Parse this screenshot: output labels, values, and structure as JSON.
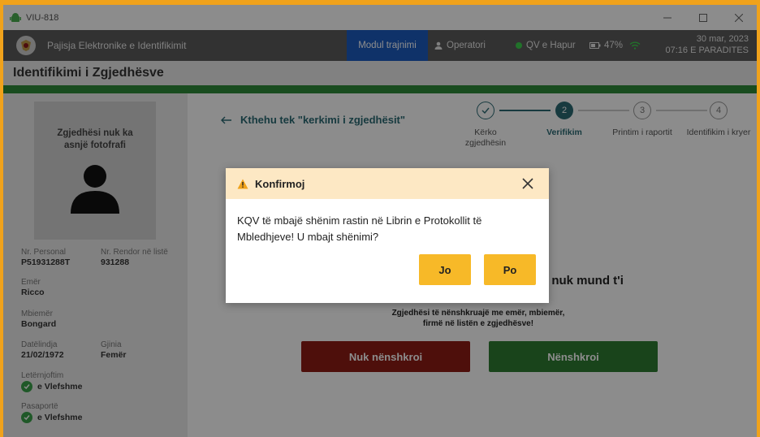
{
  "window": {
    "title": "VIU-818"
  },
  "header": {
    "app_name": "Pajisja Elektronike e Identifikimit",
    "module": "Modul trajnimi",
    "operator": "Operatori",
    "status": "QV e Hapur",
    "battery": "47%",
    "date": "30 mar, 2023",
    "time": "07:16 E PARADITES"
  },
  "page": {
    "title": "Identifikimi i Zgjedhësve"
  },
  "voter": {
    "no_photo_text": "Zgjedhësi nuk ka asnjë fotofrafi",
    "fields": {
      "personal_no_label": "Nr. Personal",
      "personal_no": "P51931288T",
      "list_no_label": "Nr. Rendor në listë",
      "list_no": "931288",
      "first_name_label": "Emër",
      "first_name": "Ricco",
      "last_name_label": "Mbiemër",
      "last_name": "Bongard",
      "dob_label": "Datëlindja",
      "dob": "21/02/1972",
      "gender_label": "Gjinia",
      "gender": "Femër",
      "id_card_label": "Letërnjoftim",
      "id_card_status": "e Vlefshme",
      "passport_label": "Pasaportë",
      "passport_status": "e Vlefshme"
    }
  },
  "main": {
    "back_link": "Kthehu tek \"kerkimi i zgjedhësit\"",
    "steps": [
      {
        "num": "1",
        "label": "Kërko zgjedhësin",
        "state": "done"
      },
      {
        "num": "2",
        "label": "Verifikim",
        "state": "active"
      },
      {
        "num": "3",
        "label": "Printim i raportit",
        "state": "pending"
      },
      {
        "num": "4",
        "label": "Identifikim i kryer",
        "state": "pending"
      }
    ],
    "heading_fragment_1": "it nuk mund t'i",
    "heading_fragment_2": "t",
    "instruction_line1": "Zgjedhësi të nënshkruajë me emër, mbiemër,",
    "instruction_line2": "firmë në listën e zgjedhësve!",
    "btn_not_signed": "Nuk nënshkroi",
    "btn_signed": "Nënshkroi"
  },
  "dialog": {
    "title": "Konfirmoj",
    "message": "KQV të mbajë shënim rastin në Librin e Protokollit të Mbledhjeve! U mbajt shënimi?",
    "no_label": "Jo",
    "yes_label": "Po"
  },
  "colors": {
    "frame": "#f0a21b",
    "header_bg": "#5c5c5c",
    "module_bg": "#1d5bbf",
    "step_active": "#2a6a74",
    "green_bar": "#2f8a3a",
    "btn_red": "#8f1d14",
    "btn_green": "#2e7d32",
    "dialog_btn": "#f7b928",
    "dialog_header": "#fde8c4"
  }
}
